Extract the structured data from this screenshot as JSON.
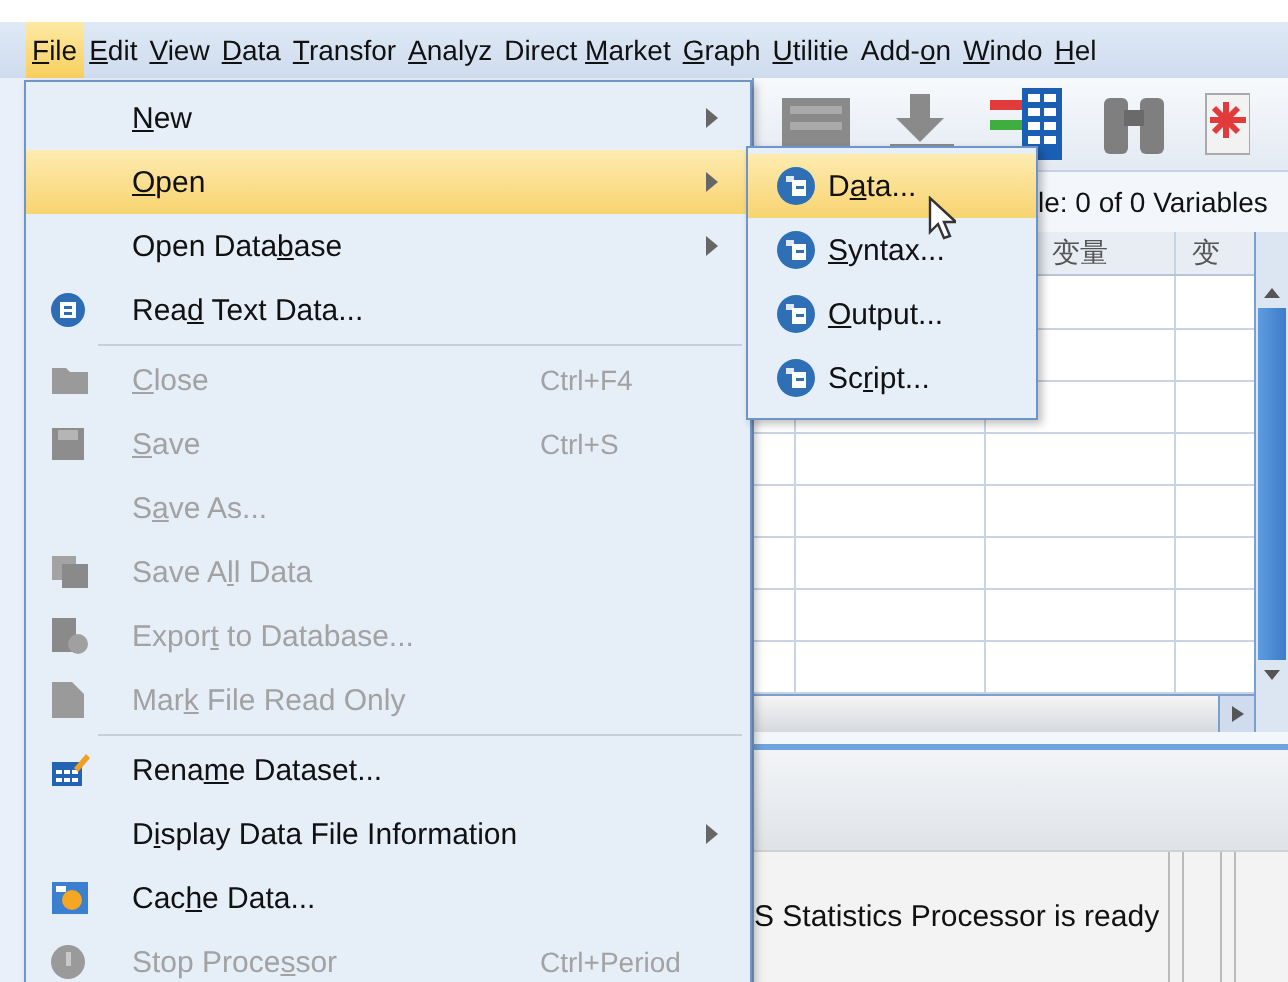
{
  "menubar": [
    {
      "key": "F",
      "post": "ile",
      "selected": true
    },
    {
      "key": "E",
      "post": "dit",
      "selected": false
    },
    {
      "key": "V",
      "post": "iew",
      "selected": false
    },
    {
      "key": "D",
      "post": "ata",
      "selected": false
    },
    {
      "key": "T",
      "post": "ransfor",
      "selected": false
    },
    {
      "key": "A",
      "post": "nalyz",
      "selected": false
    },
    {
      "pre": "Direct ",
      "key": "M",
      "post": "arket",
      "selected": false
    },
    {
      "key": "G",
      "post": "raph",
      "selected": false
    },
    {
      "key": "U",
      "post": "tilitie",
      "selected": false
    },
    {
      "pre": "Add-",
      "key": "o",
      "post": "n",
      "selected": false
    },
    {
      "key": "W",
      "post": "indo",
      "selected": false
    },
    {
      "key": "H",
      "post": "el",
      "selected": false
    }
  ],
  "file_menu": [
    {
      "kind": "item",
      "key": "N",
      "post": "ew",
      "submenu": true,
      "disabled": false,
      "selected": false
    },
    {
      "kind": "item",
      "key": "O",
      "post": "pen",
      "submenu": true,
      "disabled": false,
      "selected": true
    },
    {
      "kind": "item",
      "pre": "Open Data",
      "key": "b",
      "post": "ase",
      "submenu": true,
      "disabled": false,
      "selected": false
    },
    {
      "kind": "item",
      "pre": "Rea",
      "key": "d",
      "post": " Text Data...",
      "submenu": false,
      "disabled": false,
      "selected": false
    },
    {
      "kind": "separator"
    },
    {
      "kind": "item",
      "key": "C",
      "post": "lose",
      "shortcut": "Ctrl+F4",
      "submenu": false,
      "disabled": true,
      "selected": false
    },
    {
      "kind": "item",
      "key": "S",
      "post": "ave",
      "shortcut": "Ctrl+S",
      "submenu": false,
      "disabled": true,
      "selected": false
    },
    {
      "kind": "item",
      "pre": "S",
      "key": "a",
      "post": "ve As...",
      "submenu": false,
      "disabled": true,
      "selected": false
    },
    {
      "kind": "item",
      "pre": "Save A",
      "key": "l",
      "post": "l Data",
      "submenu": false,
      "disabled": true,
      "selected": false
    },
    {
      "kind": "item",
      "pre": "Expor",
      "key": "t",
      "post": " to Database...",
      "submenu": false,
      "disabled": true,
      "selected": false
    },
    {
      "kind": "item",
      "pre": "Mar",
      "key": "k",
      "post": " File Read Only",
      "submenu": false,
      "disabled": true,
      "selected": false
    },
    {
      "kind": "separator"
    },
    {
      "kind": "item",
      "pre": "Rena",
      "key": "m",
      "post": "e Dataset...",
      "submenu": false,
      "disabled": false,
      "selected": false
    },
    {
      "kind": "item",
      "pre": "D",
      "key": "i",
      "post": "splay Data File Information",
      "submenu": true,
      "disabled": false,
      "selected": false
    },
    {
      "kind": "item",
      "pre": "Cac",
      "key": "h",
      "post": "e Data...",
      "submenu": false,
      "disabled": false,
      "selected": false
    },
    {
      "kind": "item",
      "pre": "Stop Proce",
      "key": "s",
      "post": "sor",
      "shortcut": "Ctrl+Period",
      "submenu": false,
      "disabled": true,
      "selected": false
    }
  ],
  "open_submenu": [
    {
      "pre": "D",
      "key": "a",
      "post": "ta...",
      "selected": true
    },
    {
      "key": "S",
      "post": "yntax...",
      "selected": false
    },
    {
      "key": "O",
      "post": "utput...",
      "selected": false
    },
    {
      "pre": "Sc",
      "key": "r",
      "post": "ipt...",
      "selected": false
    }
  ],
  "variables_info": "le: 0 of 0 Variables",
  "column_headers": [
    "变量",
    "变"
  ],
  "status_bar": "S Statistics Processor is ready"
}
